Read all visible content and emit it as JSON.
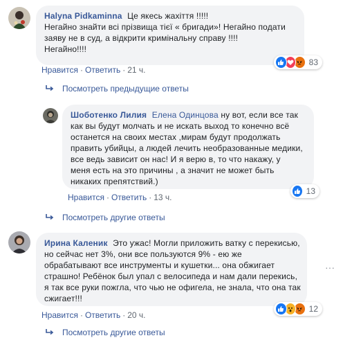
{
  "comments": [
    {
      "author": "Halyna Pidkaminna",
      "lines": [
        "Це якесь жахіття !!!!!",
        "Негайно знайти всі прізвища тієї « бригади»! Негайно подати",
        "заяву не в суд, а відкрити кримінальну справу !!!!",
        "Негайно!!!!"
      ],
      "like_label": "Нравится",
      "reply_label": "Ответить",
      "time": "21 ч.",
      "reaction_count": "83",
      "reactions": [
        "like-icon",
        "love-icon",
        "angry-icon"
      ],
      "more_replies": "Посмотреть предыдущие ответы"
    },
    {
      "author": "Шоботенко Лилия",
      "mention": "Елена Одинцова",
      "first_line_rest": "ну вот, если все так",
      "lines": [
        "как вы будут молчать и не искать выход то конечно всё",
        "останется на своих местах ,мирам будут продолжать",
        "править убийцы, а людей лечить необразованные медики,",
        "все ведь зависит он нас! И я верю в, то что накажу, у",
        "меня есть на это причины , а значит не может быть",
        "никаких препятствий.)"
      ],
      "like_label": "Нравится",
      "reply_label": "Ответить",
      "time": "13 ч.",
      "reaction_count": "13",
      "reactions": [
        "like-icon"
      ],
      "more_replies": "Посмотреть другие ответы"
    },
    {
      "author": "Ирина Калeник",
      "first_line_rest": "Это ужас! Могли приложить ватку с перекисью,",
      "lines": [
        "но сейчас нет 3%, они все пользуются 9% - ею же",
        "обрабатывают все инструменты и кушетки... она обжигает",
        "страшно! Ребёнок был упал с велосипеда и нам дали перекись,",
        "я так все руки пожгла, что чью не офигела, не знала, что она так",
        "сжигает!!!"
      ],
      "like_label": "Нравится",
      "reply_label": "Ответить",
      "time": "20 ч.",
      "reaction_count": "12",
      "reactions": [
        "like-icon",
        "wow-icon",
        "angry-icon"
      ],
      "more_replies": "Посмотреть другие ответы"
    }
  ],
  "options_glyph": "···",
  "colors": {
    "link": "#385898",
    "bubble": "#f2f3f5",
    "meta": "#606770",
    "like": "#1877f2",
    "love": "#f33e58",
    "angry": "#e9710f",
    "wow": "#f7b125"
  }
}
